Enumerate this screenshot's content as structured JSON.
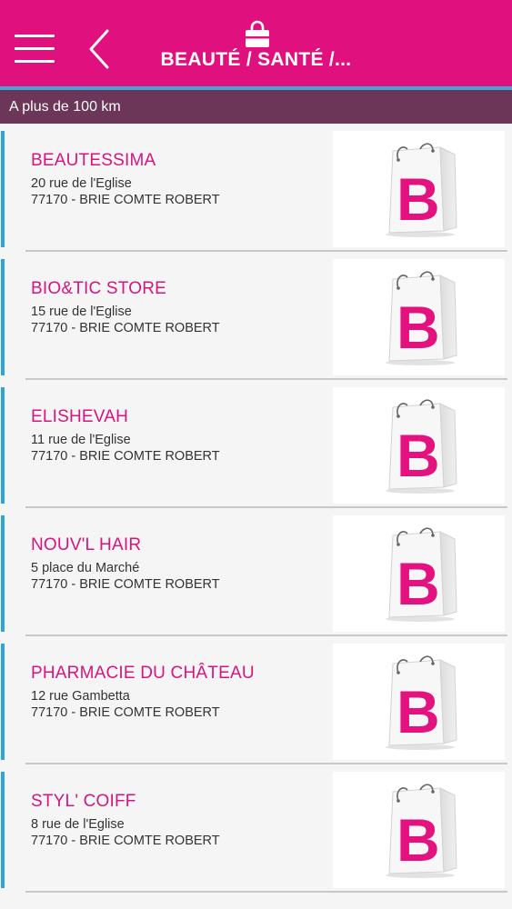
{
  "header": {
    "title": "BEAUTÉ / SANTÉ /...",
    "menu_icon": "hamburger-menu-icon",
    "back_icon": "chevron-left-icon",
    "bag_icon": "shopping-bag-icon"
  },
  "distance": {
    "label": "A plus de 100 km"
  },
  "colors": {
    "header_bg": "#e0117f",
    "accent_line": "#4aa3d4",
    "distance_bg": "#6b3657",
    "store_name": "#d6157f",
    "item_accent": "#2ea4d8"
  },
  "stores": [
    {
      "name": "BEAUTESSIMA",
      "street": "20 rue de l'Eglise",
      "city": "77170 - BRIE COMTE ROBERT",
      "logo_letter": "B"
    },
    {
      "name": "BIO&TIC STORE",
      "street": "15 rue de l'Eglise",
      "city": "77170 - BRIE COMTE ROBERT",
      "logo_letter": "B"
    },
    {
      "name": "ELISHEVAH",
      "street": "11 rue de l'Eglise",
      "city": "77170 - BRIE COMTE ROBERT",
      "logo_letter": "B"
    },
    {
      "name": "NOUV'L HAIR",
      "street": "5 place du Marché",
      "city": "77170 - BRIE COMTE ROBERT",
      "logo_letter": "B"
    },
    {
      "name": "PHARMACIE DU CHÂTEAU",
      "street": "12 rue Gambetta",
      "city": "77170 - BRIE COMTE ROBERT",
      "logo_letter": "B"
    },
    {
      "name": "STYL' COIFF",
      "street": "8 rue de l'Eglise",
      "city": "77170 - BRIE COMTE ROBERT",
      "logo_letter": "B"
    }
  ]
}
